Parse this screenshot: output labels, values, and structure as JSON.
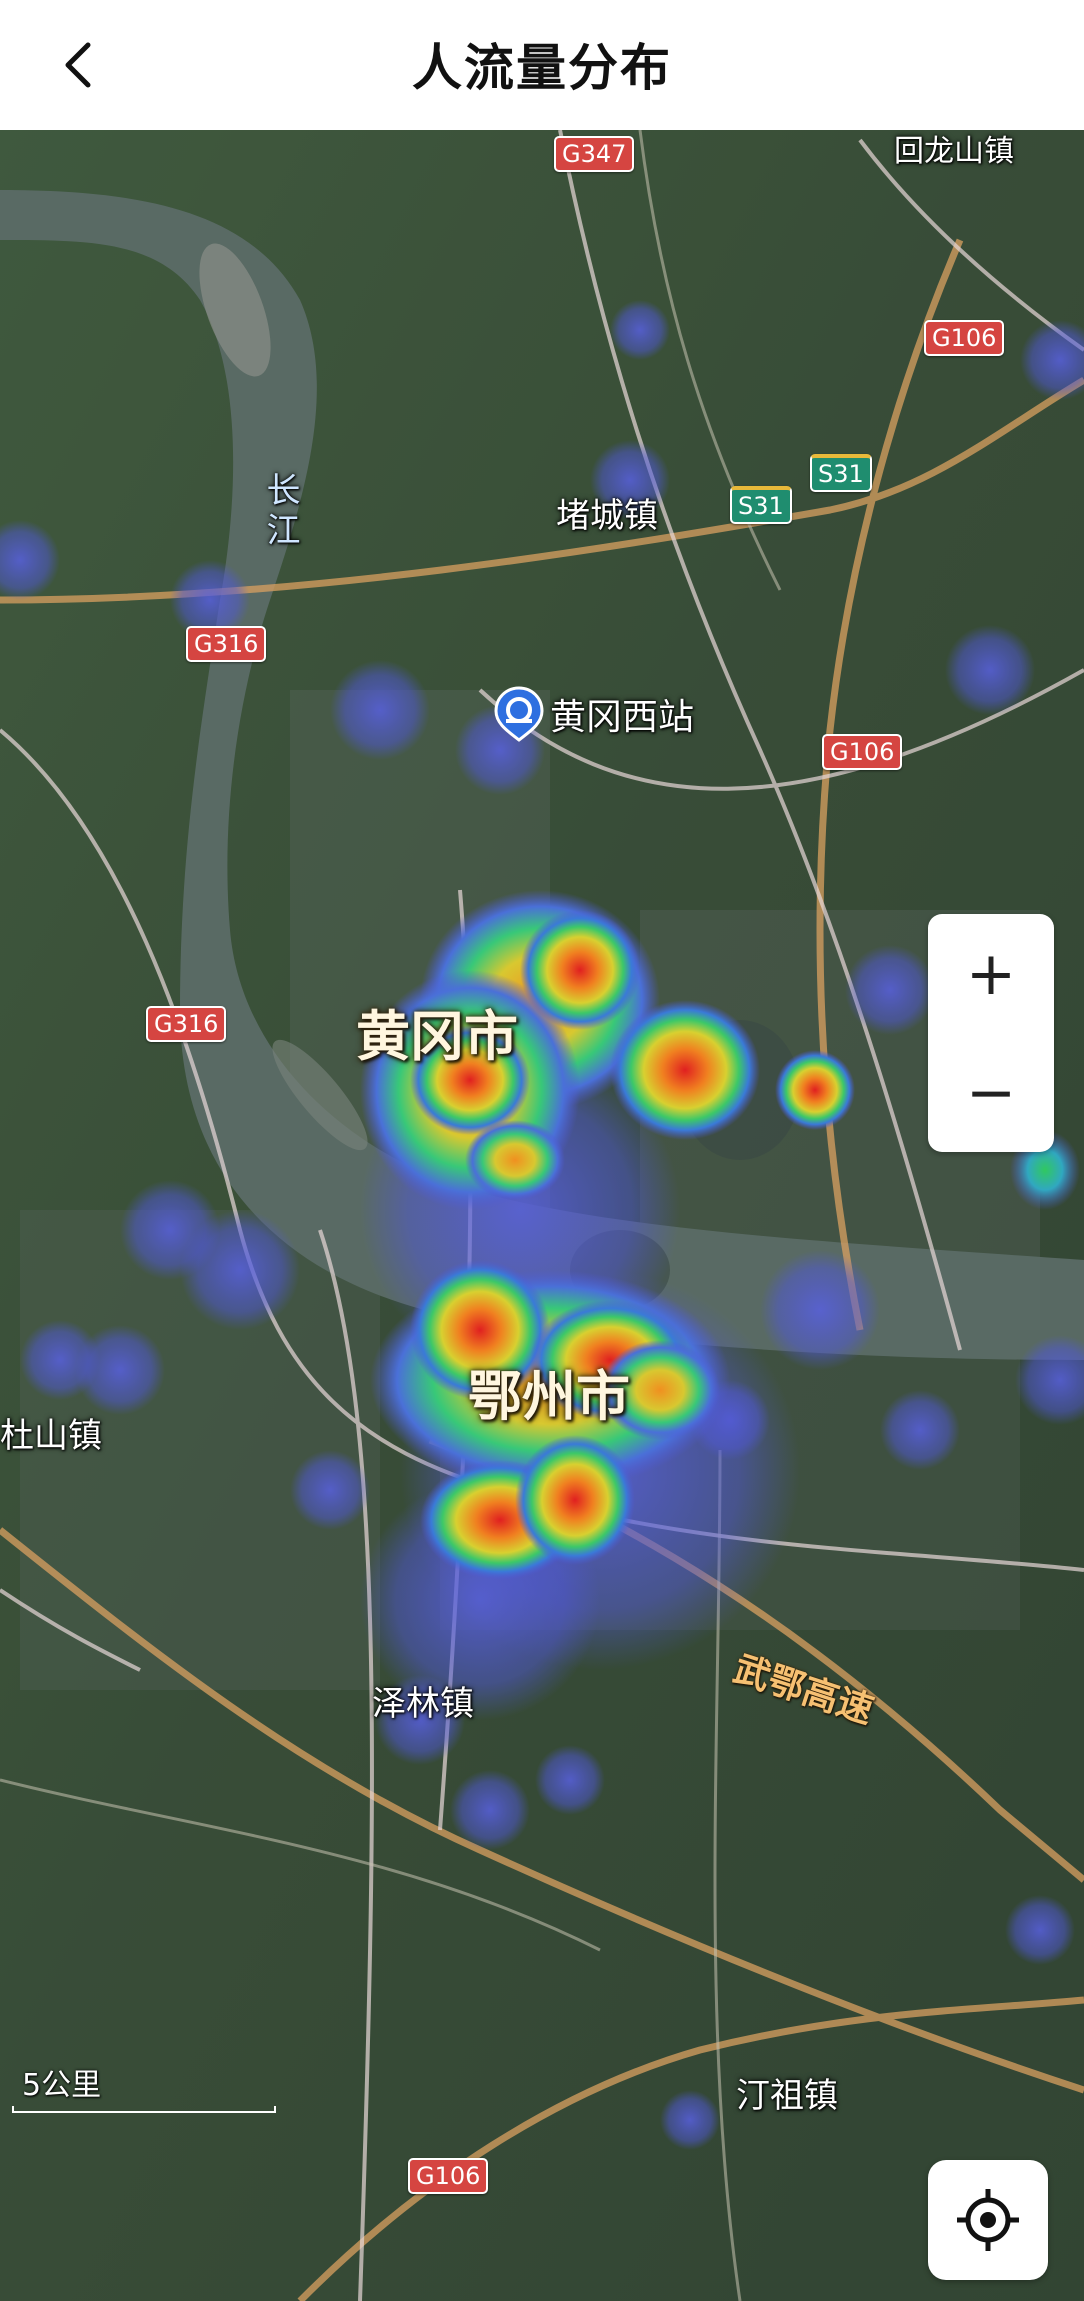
{
  "header": {
    "title": "人流量分布",
    "back_icon": "chevron-left-icon"
  },
  "map": {
    "cities": [
      {
        "id": "huanggang",
        "name": "黄冈市"
      },
      {
        "id": "ezhou",
        "name": "鄂州市"
      }
    ],
    "towns": [
      {
        "id": "huilongshan",
        "name": "回龙山镇"
      },
      {
        "id": "ducheng",
        "name": "堵城镇"
      },
      {
        "id": "dushan",
        "name": "杜山镇"
      },
      {
        "id": "zelin",
        "name": "泽林镇"
      },
      {
        "id": "tingzu",
        "name": "汀祖镇"
      }
    ],
    "river": {
      "name": "长江"
    },
    "expressway": {
      "name": "武鄂高速"
    },
    "station": {
      "name": "黄冈西站",
      "icon": "railway-station-icon"
    },
    "route_shields": [
      {
        "id": "g347",
        "code": "G347",
        "color": "#d54541"
      },
      {
        "id": "g106a",
        "code": "G106",
        "color": "#d54541"
      },
      {
        "id": "s31a",
        "code": "S31",
        "color": "#1f8d6f"
      },
      {
        "id": "s31b",
        "code": "S31",
        "color": "#1f8d6f"
      },
      {
        "id": "g316a",
        "code": "G316",
        "color": "#d54541"
      },
      {
        "id": "g106b",
        "code": "G106",
        "color": "#d54541"
      },
      {
        "id": "g316b",
        "code": "G316",
        "color": "#d54541"
      },
      {
        "id": "g106c",
        "code": "G106",
        "color": "#d54541"
      }
    ],
    "scale": {
      "label": "5公里"
    }
  },
  "controls": {
    "zoom_in": "+",
    "zoom_out": "−",
    "locate_icon": "locate-crosshair-icon"
  },
  "heatmap_colors": {
    "low": "#5058d8",
    "mid": "#2fc8a0",
    "high": "#f0a020",
    "peak": "#e02020"
  }
}
